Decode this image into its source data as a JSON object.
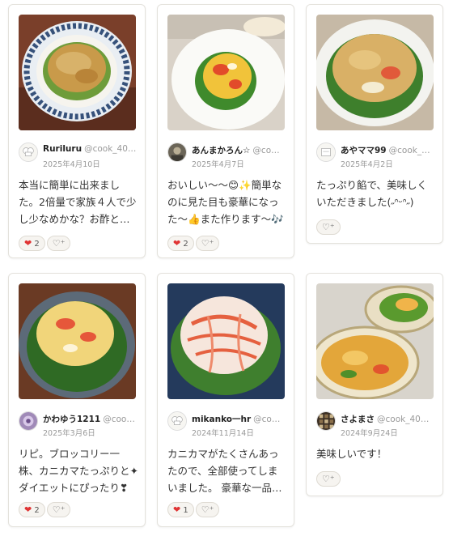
{
  "cards": [
    {
      "user": "Ruriluru",
      "handle": "@cook_40…",
      "date": "2025年4月10日",
      "comment": "本当に簡単に出来ました。2倍量で家族４人で少し少なめかな？お酢と…",
      "reaction_count": "2",
      "reaction_icon": "heart-icon",
      "add_icon": "heart-plus-icon"
    },
    {
      "user": "あんまかろん☆",
      "handle": "@co…",
      "date": "2025年4月7日",
      "comment": "おいしい〜〜😊✨簡単なのに見た目も豪華になった〜👍また作ります〜🎶",
      "reaction_count": "2",
      "reaction_icon": "heart-icon",
      "add_icon": "heart-plus-icon"
    },
    {
      "user": "あやママ99",
      "handle": "@cook_…",
      "date": "2025年4月2日",
      "comment": "たっぷり餡で、美味しくいただきました(˶ᐢᵕᐢ˶)",
      "reaction_count": "",
      "add_icon": "heart-plus-icon"
    },
    {
      "user": "かわゆう1211",
      "handle": "@coo…",
      "date": "2025年3月6日",
      "comment": "リピ。ブロッコリー一株、カニカマたっぷりと✦ダイエットにぴったり❣",
      "reaction_count": "2",
      "reaction_icon": "heart-icon",
      "add_icon": "heart-plus-icon"
    },
    {
      "user": "mikanko一hr",
      "handle": "@co…",
      "date": "2024年11月14日",
      "comment": "カニカマがたくさんあったので、全部使ってしまいました。 豪華な一品…",
      "reaction_count": "1",
      "reaction_icon": "heart-icon",
      "add_icon": "heart-plus-icon"
    },
    {
      "user": "さよまさ",
      "handle": "@cook_40…",
      "date": "2024年9月24日",
      "comment": "美味しいです！",
      "reaction_count": "",
      "add_icon": "heart-plus-icon"
    }
  ],
  "colors": {
    "reaction_heart": "#e03434",
    "card_border": "#e4e2dc",
    "muted_text": "#999999"
  }
}
